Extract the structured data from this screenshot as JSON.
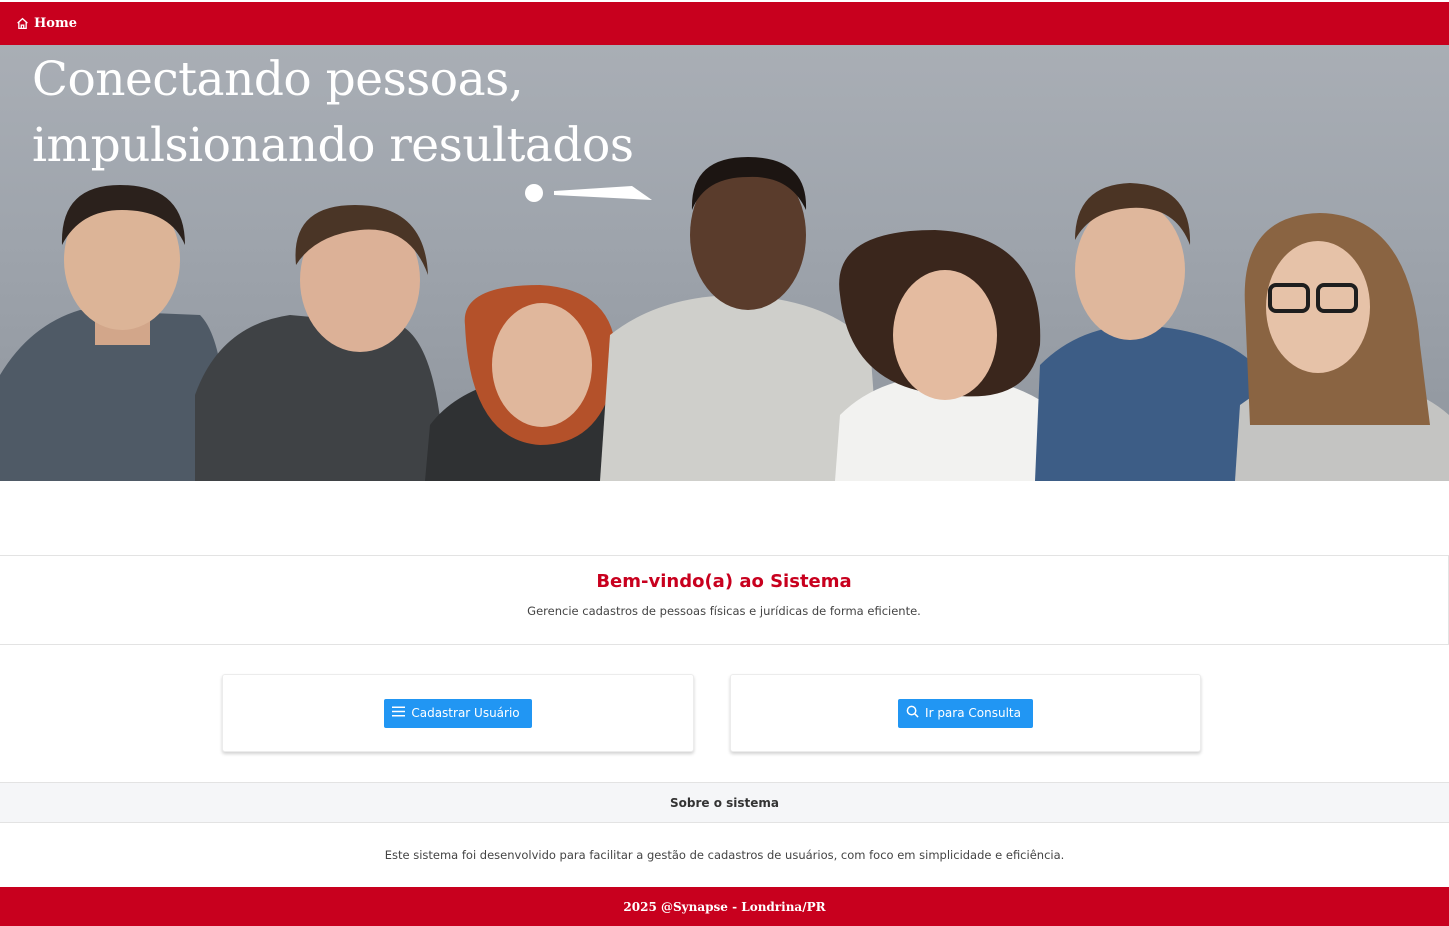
{
  "nav": {
    "home_label": "Home"
  },
  "hero": {
    "title_line1": "Conectando pessoas,",
    "title_line2": "impulsionando resultados"
  },
  "welcome": {
    "title": "Bem-vindo(a) ao Sistema",
    "subtitle": "Gerencie cadastros de pessoas físicas e jurídicas de forma eficiente."
  },
  "actions": {
    "register_label": "Cadastrar Usuário",
    "consult_label": "Ir para Consulta"
  },
  "about": {
    "header": "Sobre o sistema",
    "text": "Este sistema foi desenvolvido para facilitar a gestão de cadastros de usuários, com foco em simplicidade e eficiência."
  },
  "footer": {
    "text": "2025 @Synapse - Londrina/PR"
  },
  "colors": {
    "brand": "#c8001e",
    "button": "#2196f3"
  },
  "icons": {
    "home": "home-icon",
    "register": "menu-icon",
    "consult": "search-icon"
  }
}
